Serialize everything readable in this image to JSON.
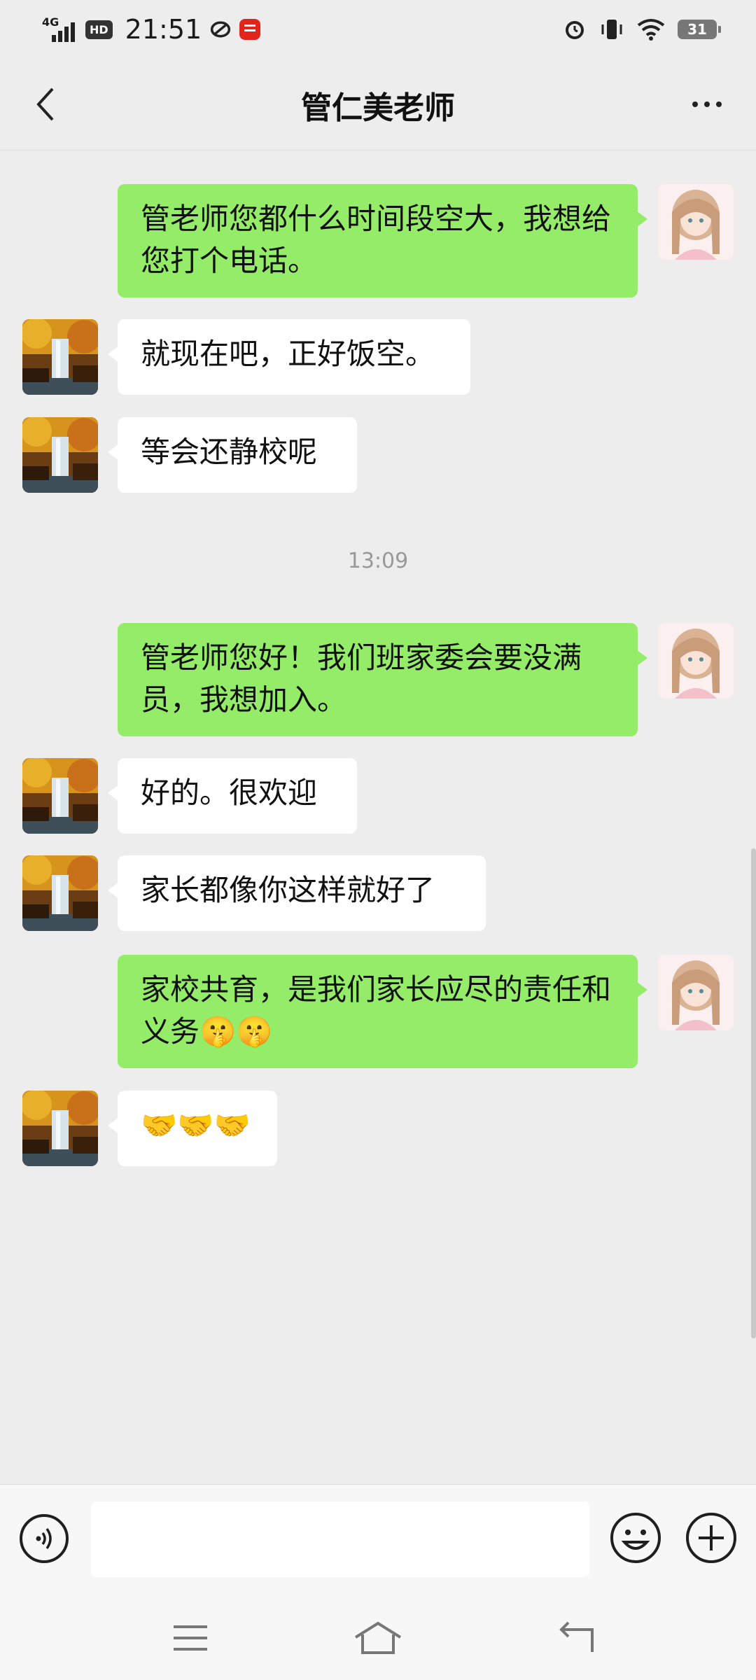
{
  "status_bar": {
    "network": "4G",
    "hd": "HD",
    "time": "21:51",
    "battery": "31"
  },
  "header": {
    "title": "管仁美老师"
  },
  "messages": [
    {
      "sender": "me",
      "text": "管老师您都什么时间段空大，我想给您打个电话。"
    },
    {
      "sender": "them",
      "text": "就现在吧，正好饭空。"
    },
    {
      "sender": "them",
      "text": "等会还静校呢"
    },
    {
      "sender": "me",
      "text": "管老师您好！我们班家委会要没满员，我想加入。"
    },
    {
      "sender": "them",
      "text": "好的。很欢迎"
    },
    {
      "sender": "them",
      "text": "家长都像你这样就好了"
    },
    {
      "sender": "me",
      "text": "家校共育，是我们家长应尽的责任和义务🤫🤫"
    },
    {
      "sender": "them",
      "text": "🤝🤝🤝"
    }
  ],
  "timestamp": "13:09",
  "input": {
    "value": "",
    "placeholder": ""
  },
  "icons": {
    "back": "chevron-left-icon",
    "more": "more-dots-icon",
    "voice": "voice-icon",
    "emoji": "emoji-icon",
    "plus": "plus-icon",
    "nav_menu": "menu-icon",
    "nav_home": "home-icon",
    "nav_back": "back-arrow-icon"
  },
  "colors": {
    "my_bubble": "#95ec69",
    "their_bubble": "#ffffff",
    "background": "#ededed"
  }
}
